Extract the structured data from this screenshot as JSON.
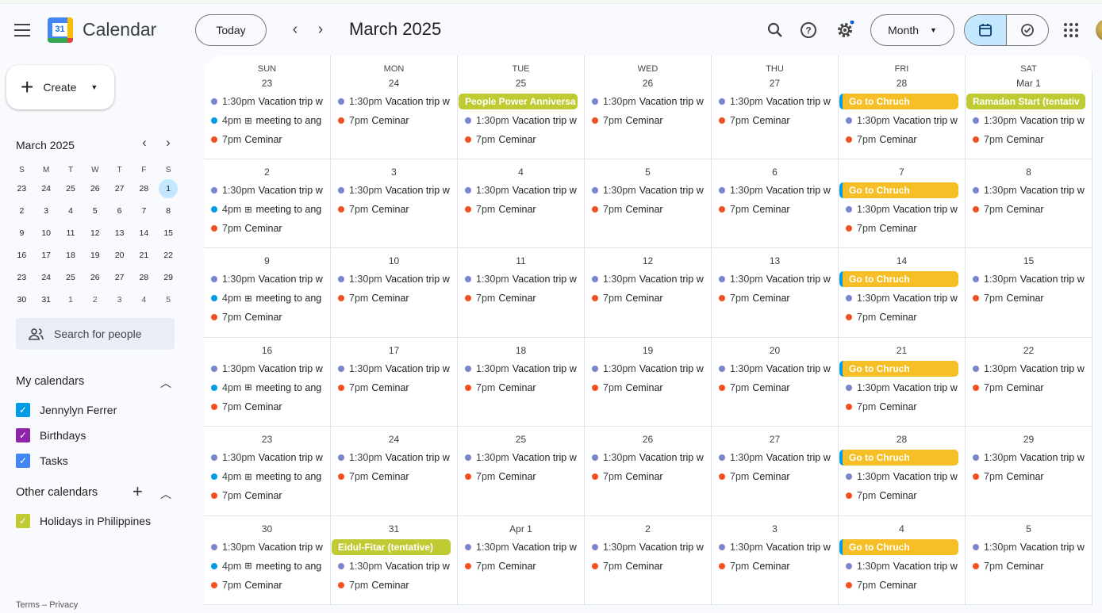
{
  "app": {
    "title": "Calendar",
    "logo_day": "31"
  },
  "header": {
    "today": "Today",
    "month_title": "March 2025",
    "view": "Month"
  },
  "sidebar": {
    "create": "Create",
    "mini_title": "March 2025",
    "mini_days": [
      "S",
      "M",
      "T",
      "W",
      "T",
      "F",
      "S"
    ],
    "mini_weeks": [
      [
        "23",
        "24",
        "25",
        "26",
        "27",
        "28",
        "1"
      ],
      [
        "2",
        "3",
        "4",
        "5",
        "6",
        "7",
        "8"
      ],
      [
        "9",
        "10",
        "11",
        "12",
        "13",
        "14",
        "15"
      ],
      [
        "16",
        "17",
        "18",
        "19",
        "20",
        "21",
        "22"
      ],
      [
        "23",
        "24",
        "25",
        "26",
        "27",
        "28",
        "29"
      ],
      [
        "30",
        "31",
        "1",
        "2",
        "3",
        "4",
        "5"
      ]
    ],
    "search_placeholder": "Search for people",
    "my_calendars": "My calendars",
    "my": [
      {
        "label": "Jennylyn Ferrer",
        "color": "#039be5"
      },
      {
        "label": "Birthdays",
        "color": "#8e24aa"
      },
      {
        "label": "Tasks",
        "color": "#4285f4"
      }
    ],
    "other_calendars": "Other calendars",
    "other": [
      {
        "label": "Holidays in Philippines",
        "color": "#c0ca33"
      }
    ],
    "footer": {
      "terms": "Terms",
      "sep": "–",
      "privacy": "Privacy"
    }
  },
  "colors": {
    "vacation": "#7986cb",
    "meeting": "#039be5",
    "ceminar": "#f4511e",
    "holiday": "#c0ca33",
    "church": "#f6bf26"
  },
  "day_names": [
    "SUN",
    "MON",
    "TUE",
    "WED",
    "THU",
    "FRI",
    "SAT"
  ],
  "weeks": [
    [
      {
        "d": "23",
        "ev": [
          {
            "k": "vacation",
            "t": "1:30pm",
            "n": "Vacation trip w"
          },
          {
            "k": "meeting",
            "t": "4pm",
            "n": "meeting to ang",
            "icon": "⊞"
          },
          {
            "k": "ceminar",
            "t": "7pm",
            "n": "Ceminar"
          }
        ]
      },
      {
        "d": "24",
        "ev": [
          {
            "k": "vacation",
            "t": "1:30pm",
            "n": "Vacation trip w"
          },
          {
            "k": "ceminar",
            "t": "7pm",
            "n": "Ceminar"
          }
        ]
      },
      {
        "d": "25",
        "ev": [
          {
            "k": "holiday",
            "n": "People Power Anniversa"
          },
          {
            "k": "vacation",
            "t": "1:30pm",
            "n": "Vacation trip w"
          },
          {
            "k": "ceminar",
            "t": "7pm",
            "n": "Ceminar"
          }
        ]
      },
      {
        "d": "26",
        "ev": [
          {
            "k": "vacation",
            "t": "1:30pm",
            "n": "Vacation trip w"
          },
          {
            "k": "ceminar",
            "t": "7pm",
            "n": "Ceminar"
          }
        ]
      },
      {
        "d": "27",
        "ev": [
          {
            "k": "vacation",
            "t": "1:30pm",
            "n": "Vacation trip w"
          },
          {
            "k": "ceminar",
            "t": "7pm",
            "n": "Ceminar"
          }
        ]
      },
      {
        "d": "28",
        "ev": [
          {
            "k": "church",
            "n": "Go to Chruch"
          },
          {
            "k": "vacation",
            "t": "1:30pm",
            "n": "Vacation trip w"
          },
          {
            "k": "ceminar",
            "t": "7pm",
            "n": "Ceminar"
          }
        ]
      },
      {
        "d": "Mar 1",
        "ev": [
          {
            "k": "holiday",
            "n": "Ramadan Start (tentativ"
          },
          {
            "k": "vacation",
            "t": "1:30pm",
            "n": "Vacation trip w"
          },
          {
            "k": "ceminar",
            "t": "7pm",
            "n": "Ceminar"
          }
        ]
      }
    ],
    [
      {
        "d": "2",
        "ev": [
          {
            "k": "vacation",
            "t": "1:30pm",
            "n": "Vacation trip w"
          },
          {
            "k": "meeting",
            "t": "4pm",
            "n": "meeting to ang",
            "icon": "⊞"
          },
          {
            "k": "ceminar",
            "t": "7pm",
            "n": "Ceminar"
          }
        ]
      },
      {
        "d": "3",
        "ev": [
          {
            "k": "vacation",
            "t": "1:30pm",
            "n": "Vacation trip w"
          },
          {
            "k": "ceminar",
            "t": "7pm",
            "n": "Ceminar"
          }
        ]
      },
      {
        "d": "4",
        "ev": [
          {
            "k": "vacation",
            "t": "1:30pm",
            "n": "Vacation trip w"
          },
          {
            "k": "ceminar",
            "t": "7pm",
            "n": "Ceminar"
          }
        ]
      },
      {
        "d": "5",
        "ev": [
          {
            "k": "vacation",
            "t": "1:30pm",
            "n": "Vacation trip w"
          },
          {
            "k": "ceminar",
            "t": "7pm",
            "n": "Ceminar"
          }
        ]
      },
      {
        "d": "6",
        "ev": [
          {
            "k": "vacation",
            "t": "1:30pm",
            "n": "Vacation trip w"
          },
          {
            "k": "ceminar",
            "t": "7pm",
            "n": "Ceminar"
          }
        ]
      },
      {
        "d": "7",
        "ev": [
          {
            "k": "church",
            "n": "Go to Chruch"
          },
          {
            "k": "vacation",
            "t": "1:30pm",
            "n": "Vacation trip w"
          },
          {
            "k": "ceminar",
            "t": "7pm",
            "n": "Ceminar"
          }
        ]
      },
      {
        "d": "8",
        "ev": [
          {
            "k": "vacation",
            "t": "1:30pm",
            "n": "Vacation trip w"
          },
          {
            "k": "ceminar",
            "t": "7pm",
            "n": "Ceminar"
          }
        ]
      }
    ],
    [
      {
        "d": "9",
        "ev": [
          {
            "k": "vacation",
            "t": "1:30pm",
            "n": "Vacation trip w"
          },
          {
            "k": "meeting",
            "t": "4pm",
            "n": "meeting to ang",
            "icon": "⊞"
          },
          {
            "k": "ceminar",
            "t": "7pm",
            "n": "Ceminar"
          }
        ]
      },
      {
        "d": "10",
        "ev": [
          {
            "k": "vacation",
            "t": "1:30pm",
            "n": "Vacation trip w"
          },
          {
            "k": "ceminar",
            "t": "7pm",
            "n": "Ceminar"
          }
        ]
      },
      {
        "d": "11",
        "ev": [
          {
            "k": "vacation",
            "t": "1:30pm",
            "n": "Vacation trip w"
          },
          {
            "k": "ceminar",
            "t": "7pm",
            "n": "Ceminar"
          }
        ]
      },
      {
        "d": "12",
        "ev": [
          {
            "k": "vacation",
            "t": "1:30pm",
            "n": "Vacation trip w"
          },
          {
            "k": "ceminar",
            "t": "7pm",
            "n": "Ceminar"
          }
        ]
      },
      {
        "d": "13",
        "ev": [
          {
            "k": "vacation",
            "t": "1:30pm",
            "n": "Vacation trip w"
          },
          {
            "k": "ceminar",
            "t": "7pm",
            "n": "Ceminar"
          }
        ]
      },
      {
        "d": "14",
        "ev": [
          {
            "k": "church",
            "n": "Go to Chruch"
          },
          {
            "k": "vacation",
            "t": "1:30pm",
            "n": "Vacation trip w"
          },
          {
            "k": "ceminar",
            "t": "7pm",
            "n": "Ceminar"
          }
        ]
      },
      {
        "d": "15",
        "ev": [
          {
            "k": "vacation",
            "t": "1:30pm",
            "n": "Vacation trip w"
          },
          {
            "k": "ceminar",
            "t": "7pm",
            "n": "Ceminar"
          }
        ]
      }
    ],
    [
      {
        "d": "16",
        "ev": [
          {
            "k": "vacation",
            "t": "1:30pm",
            "n": "Vacation trip w"
          },
          {
            "k": "meeting",
            "t": "4pm",
            "n": "meeting to ang",
            "icon": "⊞"
          },
          {
            "k": "ceminar",
            "t": "7pm",
            "n": "Ceminar"
          }
        ]
      },
      {
        "d": "17",
        "ev": [
          {
            "k": "vacation",
            "t": "1:30pm",
            "n": "Vacation trip w"
          },
          {
            "k": "ceminar",
            "t": "7pm",
            "n": "Ceminar"
          }
        ]
      },
      {
        "d": "18",
        "ev": [
          {
            "k": "vacation",
            "t": "1:30pm",
            "n": "Vacation trip w"
          },
          {
            "k": "ceminar",
            "t": "7pm",
            "n": "Ceminar"
          }
        ]
      },
      {
        "d": "19",
        "ev": [
          {
            "k": "vacation",
            "t": "1:30pm",
            "n": "Vacation trip w"
          },
          {
            "k": "ceminar",
            "t": "7pm",
            "n": "Ceminar"
          }
        ]
      },
      {
        "d": "20",
        "ev": [
          {
            "k": "vacation",
            "t": "1:30pm",
            "n": "Vacation trip w"
          },
          {
            "k": "ceminar",
            "t": "7pm",
            "n": "Ceminar"
          }
        ]
      },
      {
        "d": "21",
        "ev": [
          {
            "k": "church",
            "n": "Go to Chruch"
          },
          {
            "k": "vacation",
            "t": "1:30pm",
            "n": "Vacation trip w"
          },
          {
            "k": "ceminar",
            "t": "7pm",
            "n": "Ceminar"
          }
        ]
      },
      {
        "d": "22",
        "ev": [
          {
            "k": "vacation",
            "t": "1:30pm",
            "n": "Vacation trip w"
          },
          {
            "k": "ceminar",
            "t": "7pm",
            "n": "Ceminar"
          }
        ]
      }
    ],
    [
      {
        "d": "23",
        "ev": [
          {
            "k": "vacation",
            "t": "1:30pm",
            "n": "Vacation trip w"
          },
          {
            "k": "meeting",
            "t": "4pm",
            "n": "meeting to ang",
            "icon": "⊞"
          },
          {
            "k": "ceminar",
            "t": "7pm",
            "n": "Ceminar"
          }
        ]
      },
      {
        "d": "24",
        "ev": [
          {
            "k": "vacation",
            "t": "1:30pm",
            "n": "Vacation trip w"
          },
          {
            "k": "ceminar",
            "t": "7pm",
            "n": "Ceminar"
          }
        ]
      },
      {
        "d": "25",
        "ev": [
          {
            "k": "vacation",
            "t": "1:30pm",
            "n": "Vacation trip w"
          },
          {
            "k": "ceminar",
            "t": "7pm",
            "n": "Ceminar"
          }
        ]
      },
      {
        "d": "26",
        "ev": [
          {
            "k": "vacation",
            "t": "1:30pm",
            "n": "Vacation trip w"
          },
          {
            "k": "ceminar",
            "t": "7pm",
            "n": "Ceminar"
          }
        ]
      },
      {
        "d": "27",
        "ev": [
          {
            "k": "vacation",
            "t": "1:30pm",
            "n": "Vacation trip w"
          },
          {
            "k": "ceminar",
            "t": "7pm",
            "n": "Ceminar"
          }
        ]
      },
      {
        "d": "28",
        "ev": [
          {
            "k": "church",
            "n": "Go to Chruch"
          },
          {
            "k": "vacation",
            "t": "1:30pm",
            "n": "Vacation trip w"
          },
          {
            "k": "ceminar",
            "t": "7pm",
            "n": "Ceminar"
          }
        ]
      },
      {
        "d": "29",
        "ev": [
          {
            "k": "vacation",
            "t": "1:30pm",
            "n": "Vacation trip w"
          },
          {
            "k": "ceminar",
            "t": "7pm",
            "n": "Ceminar"
          }
        ]
      }
    ],
    [
      {
        "d": "30",
        "ev": [
          {
            "k": "vacation",
            "t": "1:30pm",
            "n": "Vacation trip w"
          },
          {
            "k": "meeting",
            "t": "4pm",
            "n": "meeting to ang",
            "icon": "⊞"
          },
          {
            "k": "ceminar",
            "t": "7pm",
            "n": "Ceminar"
          }
        ]
      },
      {
        "d": "31",
        "ev": [
          {
            "k": "holiday",
            "n": "Eidul-Fitar (tentative)"
          },
          {
            "k": "vacation",
            "t": "1:30pm",
            "n": "Vacation trip w"
          },
          {
            "k": "ceminar",
            "t": "7pm",
            "n": "Ceminar"
          }
        ]
      },
      {
        "d": "Apr 1",
        "ev": [
          {
            "k": "vacation",
            "t": "1:30pm",
            "n": "Vacation trip w"
          },
          {
            "k": "ceminar",
            "t": "7pm",
            "n": "Ceminar"
          }
        ]
      },
      {
        "d": "2",
        "ev": [
          {
            "k": "vacation",
            "t": "1:30pm",
            "n": "Vacation trip w"
          },
          {
            "k": "ceminar",
            "t": "7pm",
            "n": "Ceminar"
          }
        ]
      },
      {
        "d": "3",
        "ev": [
          {
            "k": "vacation",
            "t": "1:30pm",
            "n": "Vacation trip w"
          },
          {
            "k": "ceminar",
            "t": "7pm",
            "n": "Ceminar"
          }
        ]
      },
      {
        "d": "4",
        "ev": [
          {
            "k": "church",
            "n": "Go to Chruch"
          },
          {
            "k": "vacation",
            "t": "1:30pm",
            "n": "Vacation trip w"
          },
          {
            "k": "ceminar",
            "t": "7pm",
            "n": "Ceminar"
          }
        ]
      },
      {
        "d": "5",
        "ev": [
          {
            "k": "vacation",
            "t": "1:30pm",
            "n": "Vacation trip w"
          },
          {
            "k": "ceminar",
            "t": "7pm",
            "n": "Ceminar"
          }
        ]
      }
    ]
  ]
}
